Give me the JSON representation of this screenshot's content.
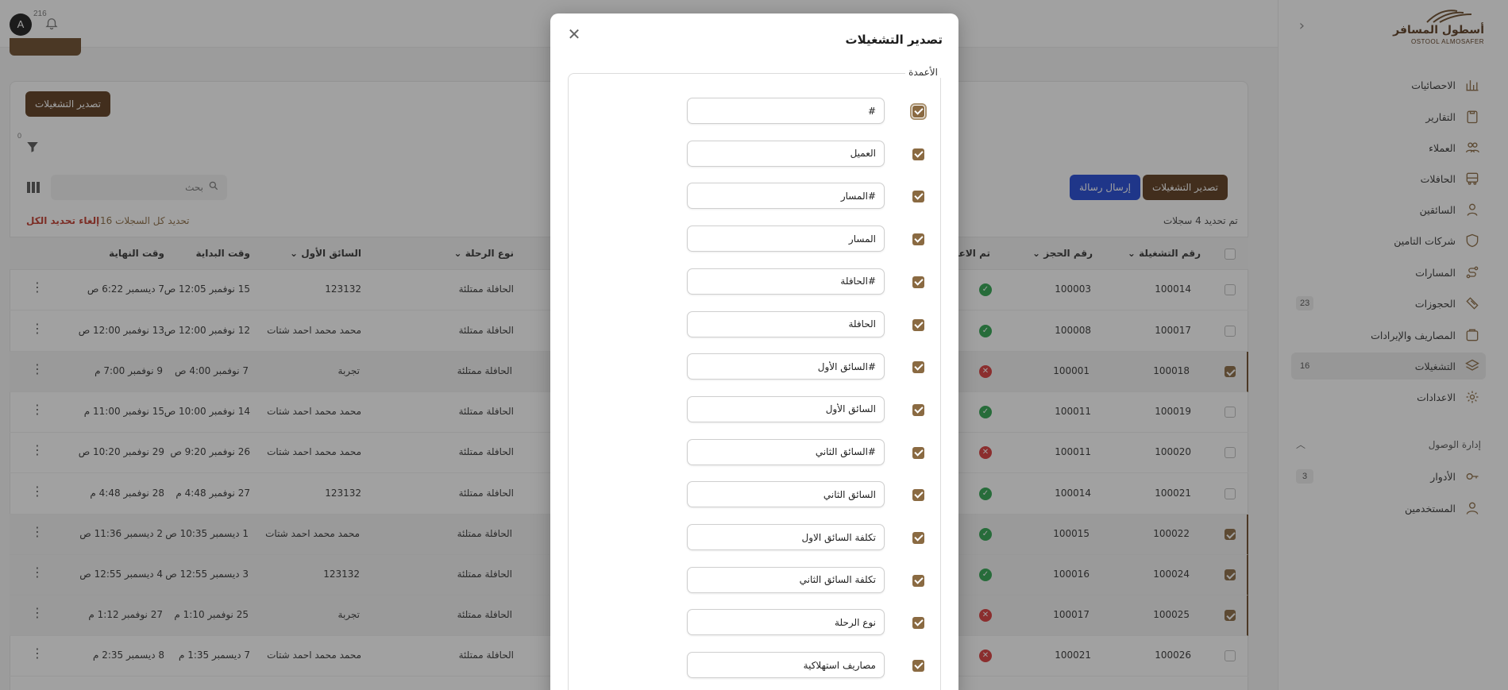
{
  "topbar": {
    "avatar_letter": "A",
    "notifications_count": "216"
  },
  "brand": {
    "name_ar": "أسطول المسافر",
    "name_en": "OSTOOL ALMOSAFER"
  },
  "sidebar": {
    "items": [
      {
        "label": "الاحصائيات",
        "icon": "chart-bars-icon"
      },
      {
        "label": "التقارير",
        "icon": "clipboard-icon"
      },
      {
        "label": "العملاء",
        "icon": "users-icon"
      },
      {
        "label": "الحافلات",
        "icon": "bus-icon"
      },
      {
        "label": "السائقين",
        "icon": "driver-icon"
      },
      {
        "label": "شركات التامين",
        "icon": "shield-icon"
      },
      {
        "label": "المسارات",
        "icon": "route-icon"
      },
      {
        "label": "الحجوزات",
        "icon": "ticket-icon",
        "badge": "23"
      },
      {
        "label": "المصاريف والإيرادات",
        "icon": "wallet-icon"
      },
      {
        "label": "التشغيلات",
        "icon": "layers-icon",
        "badge": "16",
        "active": true
      },
      {
        "label": "الاعدادات",
        "icon": "gear-icon"
      }
    ],
    "access_section": {
      "title": "إدارة الوصول",
      "items": [
        {
          "label": "الأدوار",
          "icon": "key-icon",
          "badge": "3"
        },
        {
          "label": "المستخدمين",
          "icon": "user-group-icon"
        }
      ]
    }
  },
  "toolbar": {
    "export_label": "تصدير التشغيلات",
    "send_message_label": "إرسال رسالة",
    "export_right_label": "تصدير التشغيلات",
    "filter_count": "0",
    "search_placeholder": "بحث"
  },
  "selection": {
    "selected_text": "تم تحديد 4 سجلات",
    "select_all_text": "تحديد كل السجلات 16",
    "clear_text": "إلغاء تحديد الكل"
  },
  "table": {
    "headers": {
      "operation_no": "رقم التشغيلة",
      "booking_no": "رقم الحجز",
      "approved": "تم الاعتماد",
      "trip_type": "نوع الرحلة",
      "first_driver": "السائق الأول",
      "start_time": "وقت البداية",
      "end_time": "وقت النهاية"
    },
    "rows": [
      {
        "op": "100014",
        "booking": "100003",
        "approved": true,
        "trip": "الحافلة ممتلئة",
        "driver": "123132",
        "start": "15 نوفمبر 12:05 ص",
        "end": "7 ديسمبر 6:22 ص",
        "selected": false
      },
      {
        "op": "100017",
        "booking": "100008",
        "approved": true,
        "trip": "الحافلة ممتلئة",
        "driver": "محمد محمد احمد شتات",
        "start": "12 نوفمبر 12:00 ص",
        "end": "13 نوفمبر 12:00 ص",
        "selected": false
      },
      {
        "op": "100018",
        "booking": "100001",
        "approved": false,
        "trip": "الحافلة ممتلئة",
        "driver": "تجربة",
        "start": "7 نوفمبر 4:00 ص",
        "end": "9 نوفمبر 7:00 م",
        "selected": true
      },
      {
        "op": "100019",
        "booking": "100011",
        "approved": true,
        "trip": "الحافلة ممتلئة",
        "driver": "محمد محمد احمد شتات",
        "start": "14 نوفمبر 10:00 ص",
        "end": "15 نوفمبر 11:00 م",
        "selected": false
      },
      {
        "op": "100020",
        "booking": "100011",
        "approved": false,
        "trip": "الحافلة ممتلئة",
        "driver": "محمد محمد احمد شتات",
        "start": "26 نوفمبر 9:20 ص",
        "end": "29 نوفمبر 10:20 ص",
        "selected": false
      },
      {
        "op": "100021",
        "booking": "100014",
        "approved": true,
        "trip": "الحافلة ممتلئة",
        "driver": "123132",
        "start": "27 نوفمبر 4:48 م",
        "end": "28 نوفمبر 4:48 م",
        "selected": false
      },
      {
        "op": "100022",
        "booking": "100015",
        "approved": true,
        "trip": "الحافلة ممتلئة",
        "driver": "محمد محمد احمد شتات",
        "start": "1 ديسمبر 10:35 ص",
        "end": "2 ديسمبر 11:36 ص",
        "selected": true
      },
      {
        "op": "100024",
        "booking": "100016",
        "approved": true,
        "trip": "الحافلة ممتلئة",
        "driver": "123132",
        "start": "3 ديسمبر 12:55 ص",
        "end": "4 ديسمبر 12:55 ص",
        "selected": true
      },
      {
        "op": "100025",
        "booking": "100017",
        "approved": false,
        "trip": "الحافلة ممتلئة",
        "driver": "تجربة",
        "start": "25 نوفمبر 1:10 م",
        "end": "27 نوفمبر 1:12 م",
        "selected": true
      },
      {
        "op": "100026",
        "booking": "100021",
        "approved": false,
        "trip": "الحافلة ممتلئة",
        "driver": "محمد محمد احمد شتات",
        "start": "7 ديسمبر 1:35 م",
        "end": "8 ديسمبر 2:35 م",
        "selected": false
      }
    ]
  },
  "modal": {
    "title": "تصدير التشغيلات",
    "legend": "الأعمدة",
    "columns": [
      {
        "value": "#",
        "checked": true
      },
      {
        "value": "العميل",
        "checked": true
      },
      {
        "value": "#المسار",
        "checked": true
      },
      {
        "value": "المسار",
        "checked": true
      },
      {
        "value": "#الحافلة",
        "checked": true
      },
      {
        "value": "الحافلة",
        "checked": true
      },
      {
        "value": "#السائق الأول",
        "checked": true
      },
      {
        "value": "السائق الأول",
        "checked": true
      },
      {
        "value": "#السائق الثاني",
        "checked": true
      },
      {
        "value": "السائق الثاني",
        "checked": true
      },
      {
        "value": "تكلفة السائق الاول",
        "checked": true
      },
      {
        "value": "تكلفة السائق الثاني",
        "checked": true
      },
      {
        "value": "نوع الرحلة",
        "checked": true
      },
      {
        "value": "مصاريف استهلاكية",
        "checked": true
      }
    ]
  },
  "colors": {
    "brand_brown": "#5c3a1c",
    "accent_check": "#8a6a42",
    "blue": "#1f47d6",
    "ok_green": "#2ea44f",
    "no_red": "#d93a3a"
  }
}
